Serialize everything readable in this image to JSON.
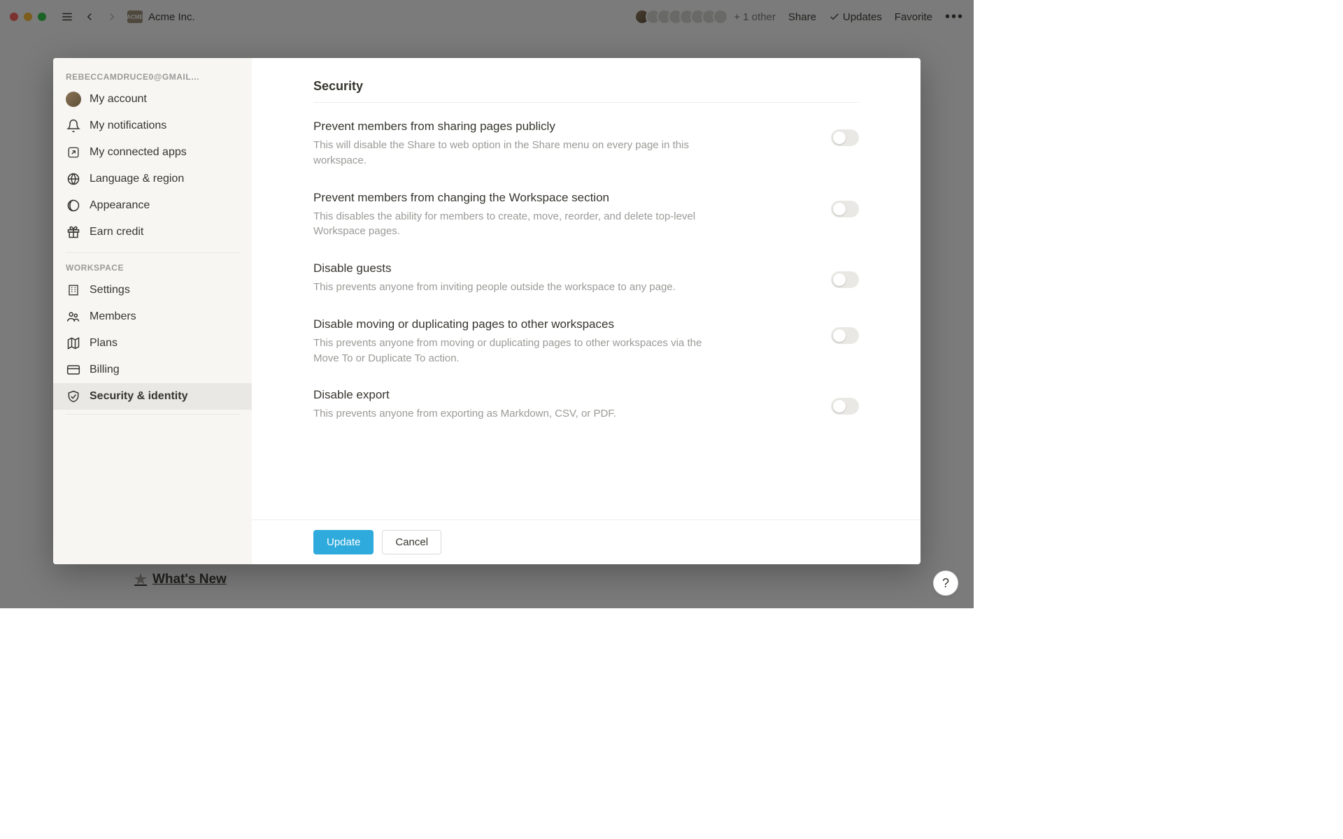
{
  "toolbar": {
    "breadcrumb_label": "Acme Inc.",
    "collab_more": "+ 1 other",
    "share": "Share",
    "updates": "Updates",
    "favorite": "Favorite"
  },
  "sidebar": {
    "account_email": "REBECCAMDRUCE0@GMAIL…",
    "section_account": [
      {
        "label": "My account"
      },
      {
        "label": "My notifications"
      },
      {
        "label": "My connected apps"
      },
      {
        "label": "Language & region"
      },
      {
        "label": "Appearance"
      },
      {
        "label": "Earn credit"
      }
    ],
    "section_workspace_label": "WORKSPACE",
    "section_workspace": [
      {
        "label": "Settings"
      },
      {
        "label": "Members"
      },
      {
        "label": "Plans"
      },
      {
        "label": "Billing"
      },
      {
        "label": "Security & identity"
      }
    ]
  },
  "main": {
    "title": "Security",
    "settings": [
      {
        "title": "Prevent members from sharing pages publicly",
        "desc": "This will disable the Share to web option in the Share menu on every page in this workspace.",
        "on": false
      },
      {
        "title": "Prevent members from changing the Workspace section",
        "desc": "This disables the ability for members to create, move, reorder, and delete top-level Workspace pages.",
        "on": false
      },
      {
        "title": "Disable guests",
        "desc": "This prevents anyone from inviting people outside the workspace to any page.",
        "on": false
      },
      {
        "title": "Disable moving or duplicating pages to other workspaces",
        "desc": "This prevents anyone from moving or duplicating pages to other workspaces via the Move To or Duplicate To action.",
        "on": false
      },
      {
        "title": "Disable export",
        "desc": "This prevents anyone from exporting as Markdown, CSV, or PDF.",
        "on": false
      }
    ],
    "update_label": "Update",
    "cancel_label": "Cancel"
  },
  "background_page": {
    "label": "What's New"
  },
  "help_label": "?"
}
